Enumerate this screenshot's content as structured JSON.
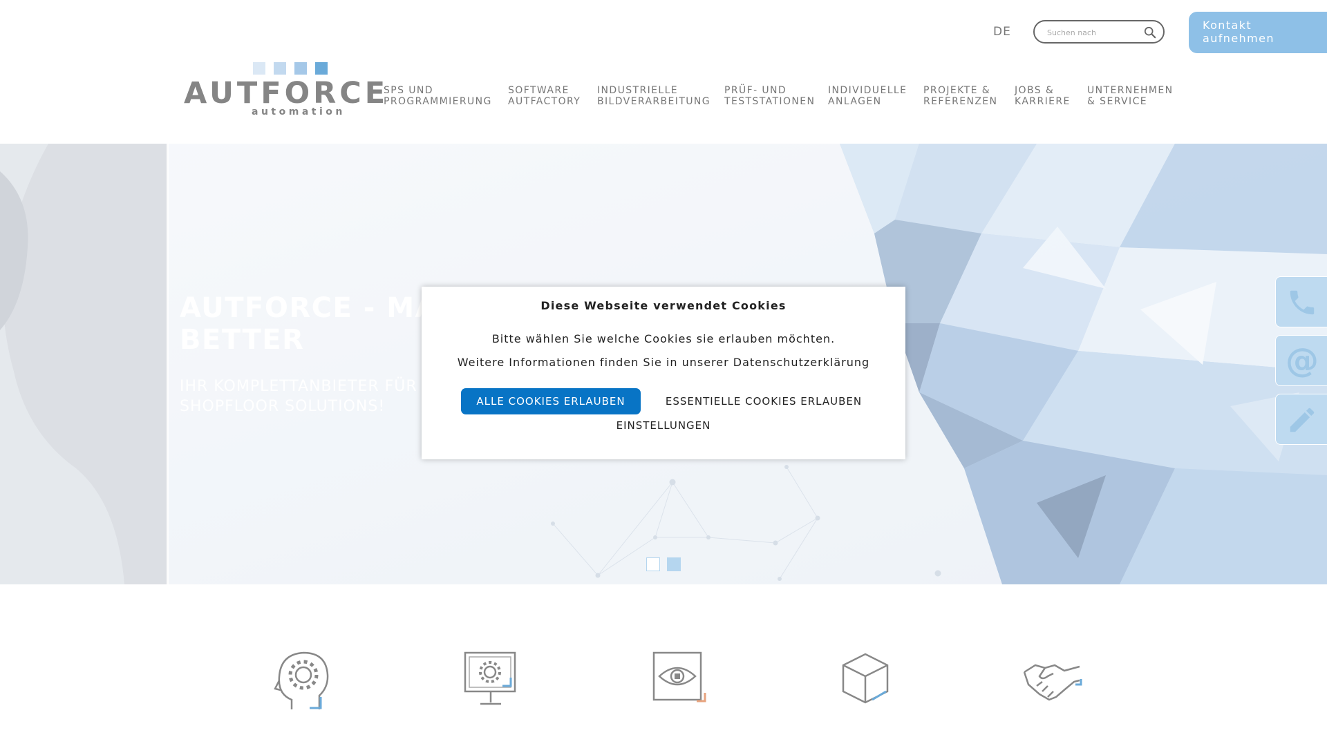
{
  "header": {
    "language": "DE",
    "search_placeholder": "Suchen nach",
    "contact_button": "Kontakt\naufnehmen"
  },
  "logo": {
    "wordmark": "AUTFORCE",
    "tagline": "automation",
    "square_colors": [
      "#dbe8f5",
      "#c2d9ef",
      "#a5c8e8",
      "#6aaad9"
    ]
  },
  "nav": {
    "items": [
      {
        "label": "SPS UND\nPROGRAMMIERUNG"
      },
      {
        "label": "SOFTWARE\nAUTFACTORY"
      },
      {
        "label": "INDUSTRIELLE\nBILDVERARBEITUNG"
      },
      {
        "label": "PRÜF- UND\nTESTSTATIONEN"
      },
      {
        "label": "INDIVIDUELLE\nANLAGEN"
      },
      {
        "label": "PROJEKTE &\nREFERENZEN"
      },
      {
        "label": "JOBS &\nKARRIERE"
      },
      {
        "label": "UNTERNEHMEN\n& SERVICE"
      }
    ]
  },
  "hero": {
    "title": "AUTFORCE - MA\nBETTER",
    "subtitle": "IHR KOMPLETTANBIETER FÜR\nSHOPFLOOR SOLUTIONS!",
    "slides": 2,
    "active_slide": 2
  },
  "side_contact": {
    "icons": [
      "phone-icon",
      "at-icon",
      "pencil-icon"
    ]
  },
  "cookie_dialog": {
    "title": "Diese Webseite verwendet Cookies",
    "line1": "Bitte wählen Sie welche Cookies sie erlauben möchten.",
    "line2": "Weitere Informationen finden Sie in unserer Datenschutzerklärung",
    "allow_all": "ALLE COOKIES ERLAUBEN",
    "essential": "ESSENTIELLE COOKIES ERLAUBEN",
    "settings": "EINSTELLUNGEN"
  },
  "features": {
    "icons": [
      "head-gear-icon",
      "monitor-gear-icon",
      "eye-scan-icon",
      "cube-icon",
      "handshake-icon"
    ]
  },
  "colors": {
    "accent": "#0874c5",
    "light_blue": "#8ec0e7",
    "text_gray": "#777777"
  }
}
